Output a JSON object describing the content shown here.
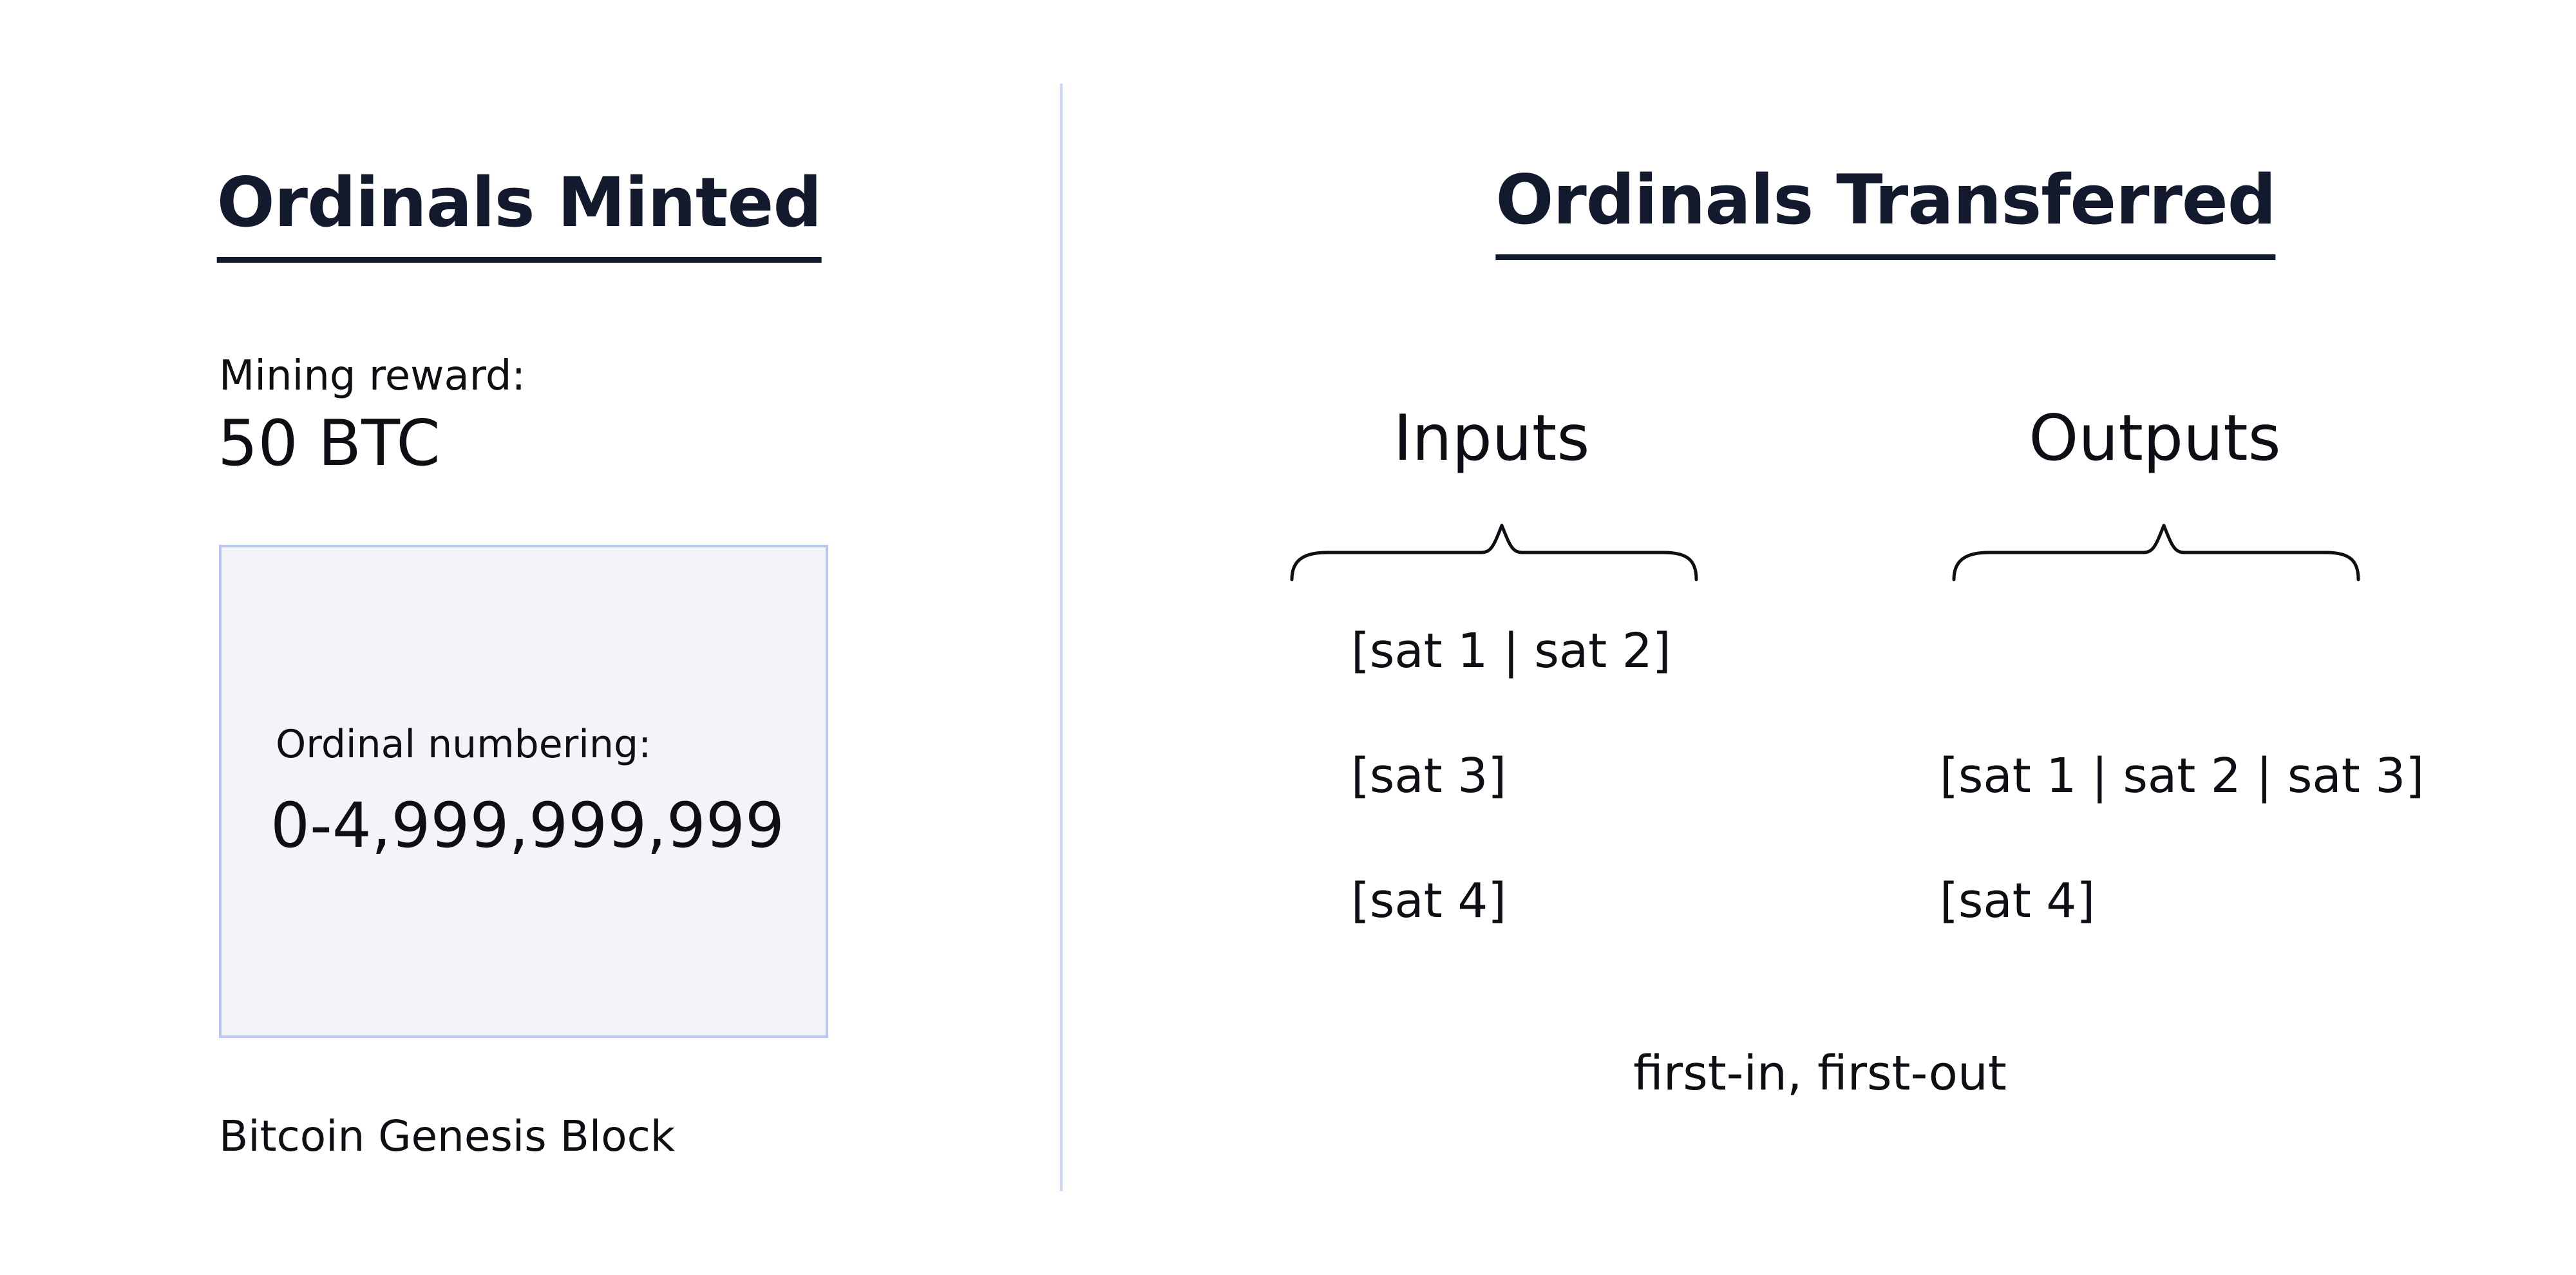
{
  "left": {
    "title": "Ordinals Minted",
    "reward_label": "Mining reward:",
    "reward_value": "50 BTC",
    "numbering_label": "Ordinal numbering:",
    "numbering_value": "0-4,999,999,999",
    "caption": "Bitcoin Genesis Block"
  },
  "right": {
    "title": "Ordinals Transferred",
    "inputs_heading": "Inputs",
    "outputs_heading": "Outputs",
    "inputs": [
      "[sat 1 | sat 2]",
      "[sat 3]",
      "[sat 4]"
    ],
    "outputs": [
      "[sat 1 | sat 2 | sat 3]",
      "[sat 4]"
    ],
    "footer": "first-in, first-out"
  },
  "colors": {
    "title": "#141a2e",
    "divider": "#ccd6f4",
    "box_fill": "#f3f4f8",
    "box_border": "#b9c7f0"
  }
}
